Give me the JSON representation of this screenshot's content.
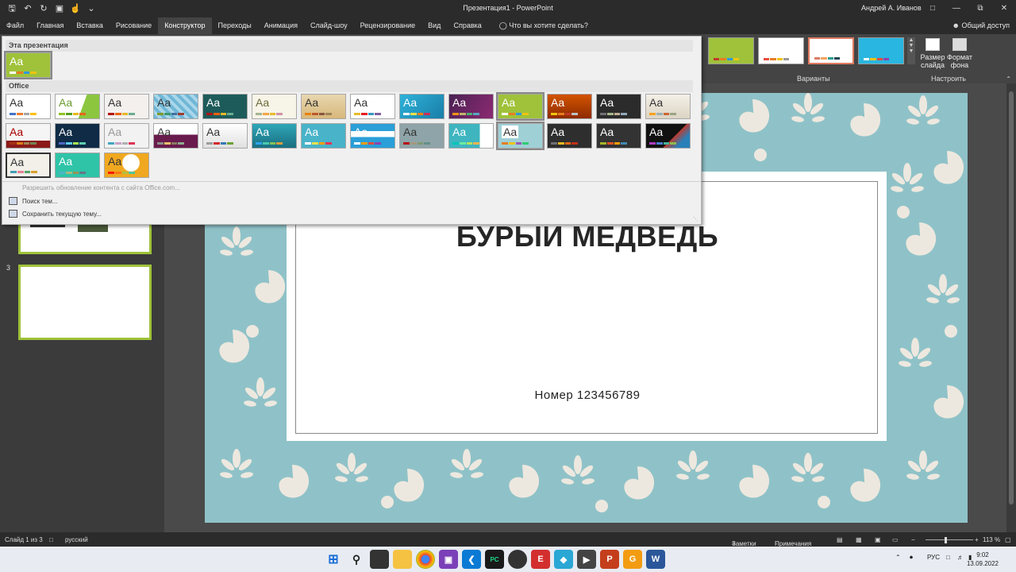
{
  "window": {
    "title": "Презентация1  -  PowerPoint",
    "user": "Андрей А. Иванов"
  },
  "tabs": [
    "Файл",
    "Главная",
    "Вставка",
    "Рисование",
    "Конструктор",
    "Переходы",
    "Анимация",
    "Слайд-шоу",
    "Рецензирование",
    "Вид",
    "Справка"
  ],
  "active_tab": "Конструктор",
  "tell_me": "Что вы хотите сделать?",
  "share": "Общий доступ",
  "ribbon": {
    "variants_label": "Варианты",
    "customize_label": "Настроить",
    "slide_size": "Размер слайда",
    "background_format": "Формат фона"
  },
  "gallery": {
    "this_presentation": "Эта презентация",
    "office": "Office",
    "aa": "Aa",
    "allow_updates": "Разрешить обновление контента с сайта Office.com...",
    "search_themes": "Поиск тем...",
    "save_theme": "Сохранить текущую тему..."
  },
  "slides_pane": {
    "slide3_number": "3"
  },
  "slide": {
    "title": "БУРЫЙ МЕДВЕДЬ",
    "subtitle": "Номер 123456789"
  },
  "status": {
    "slide_counter": "Слайд 1 из 3",
    "language": "русский",
    "notes": "Заметки",
    "comments": "Примечания",
    "zoom": "113 %"
  },
  "taskbar": {
    "lang": "РУС",
    "time": "9:02",
    "date": "13.09.2022"
  }
}
